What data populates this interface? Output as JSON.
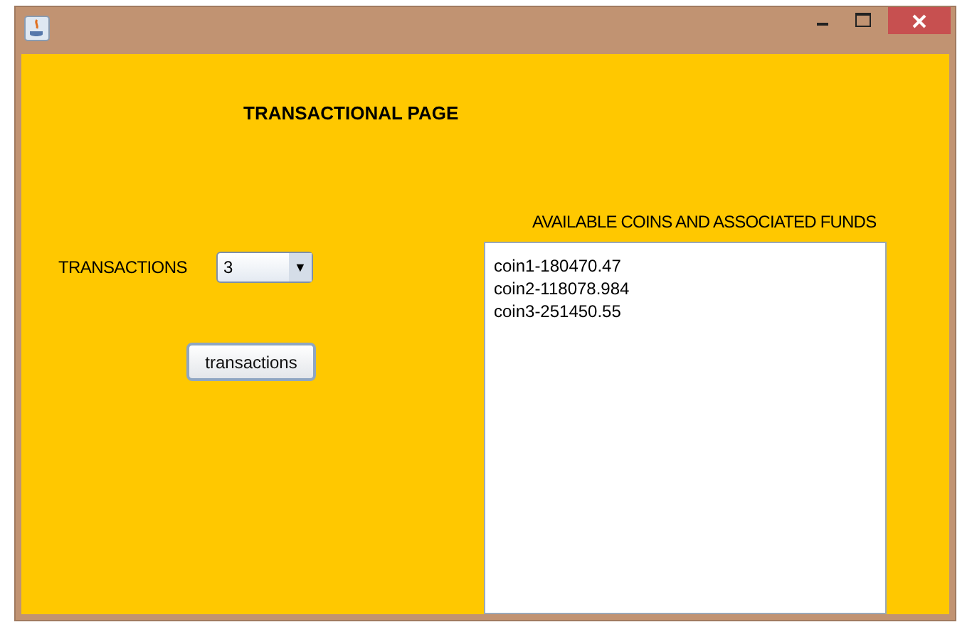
{
  "page_title": "TRANSACTIONAL PAGE",
  "transactions_label": "TRANSACTIONS",
  "transactions_select": {
    "value": "3",
    "arrow": "▼"
  },
  "transactions_button": "transactions",
  "funds_heading": "AVAILABLE COINS AND ASSOCIATED FUNDS",
  "funds_list": [
    "coin1-180470.47",
    "coin2-118078.984",
    "coin3-251450.55"
  ]
}
